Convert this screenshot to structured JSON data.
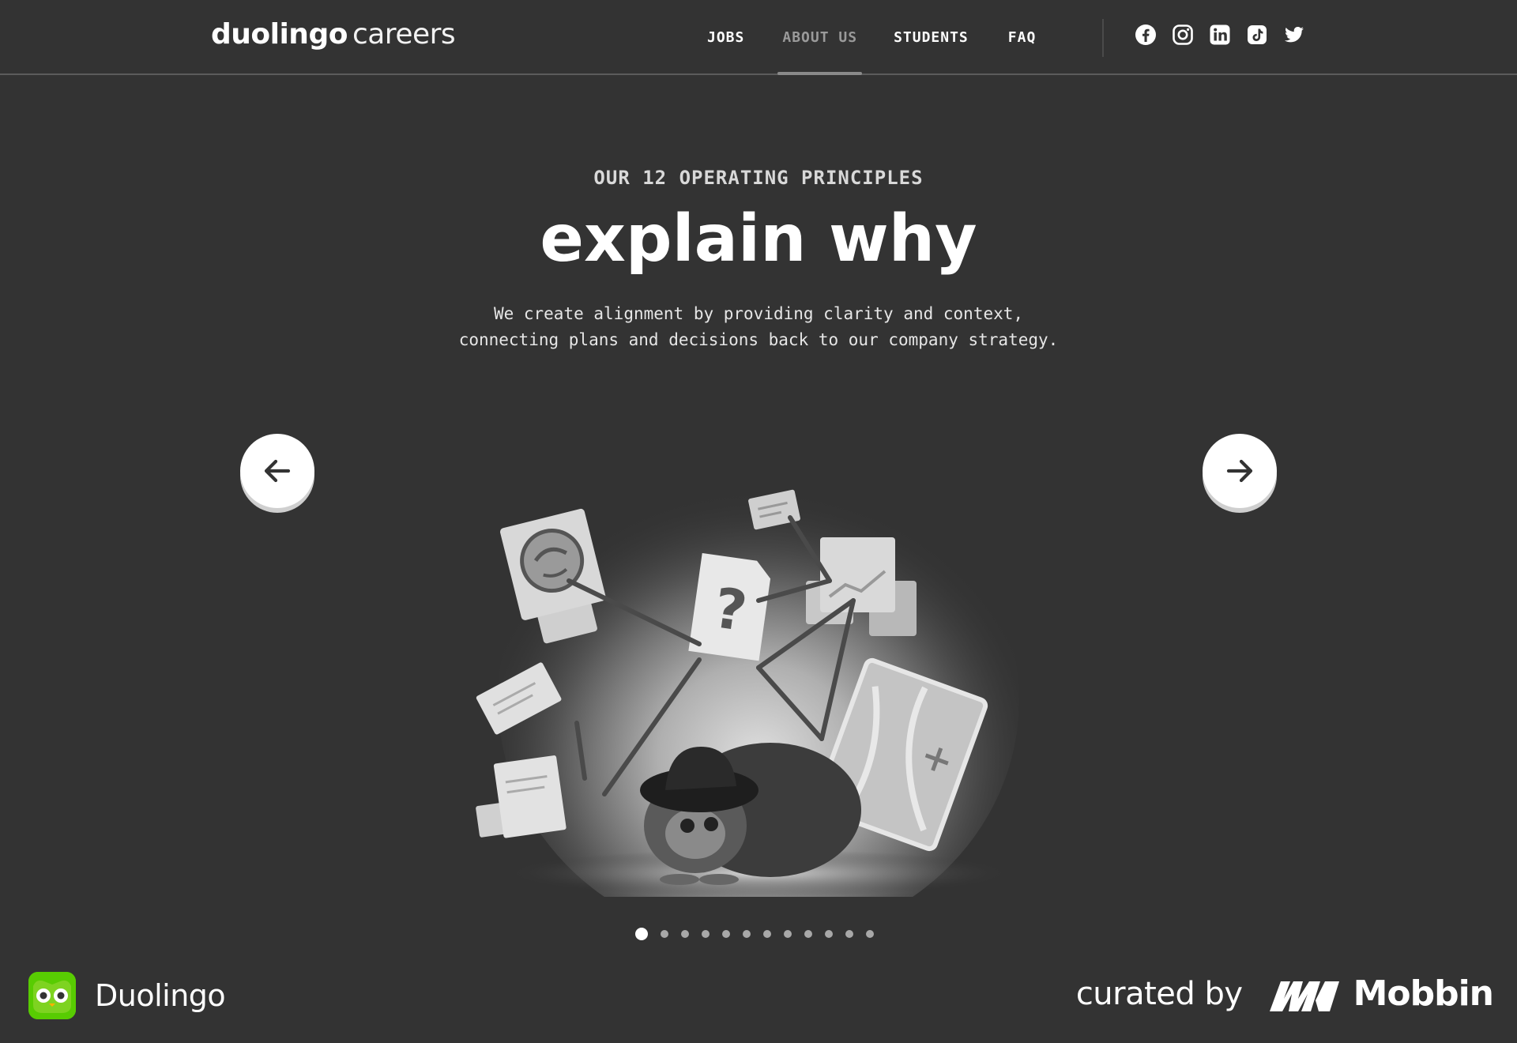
{
  "header": {
    "brand_bold": "duolingo",
    "brand_light": "careers",
    "nav": [
      {
        "label": "JOBS",
        "active": false
      },
      {
        "label": "ABOUT US",
        "active": true
      },
      {
        "label": "STUDENTS",
        "active": false
      },
      {
        "label": "FAQ",
        "active": false
      }
    ],
    "socials": [
      "facebook-icon",
      "instagram-icon",
      "linkedin-icon",
      "tiktok-icon",
      "twitter-icon"
    ]
  },
  "hero": {
    "eyebrow": "OUR 12 OPERATING PRINCIPLES",
    "title": "explain why",
    "description_line1": "We create alignment by providing clarity and context,",
    "description_line2": "connecting plans and decisions back to our company strategy."
  },
  "carousel": {
    "prev_icon": "arrow-left-icon",
    "next_icon": "arrow-right-icon",
    "total_slides": 12,
    "current_slide": 1,
    "illustration": "detective-owl-illustration"
  },
  "footer": {
    "app_name": "Duolingo",
    "curated_by": "curated by",
    "curator_name": "Mobbin"
  },
  "colors": {
    "background": "#333333",
    "text": "#ffffff",
    "nav_active": "#9a9a9a",
    "duolingo_green": "#58cc02"
  }
}
